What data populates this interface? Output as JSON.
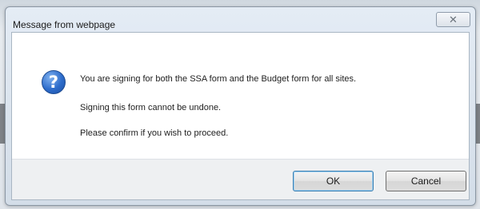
{
  "dialog": {
    "title": "Message from webpage",
    "close_glyph": "✕",
    "icon": "question-icon",
    "icon_glyph": "?",
    "messages": [
      "You are signing for both the SSA form and the Budget form for all sites.",
      "Signing this form cannot be undone.",
      "Please confirm if you wish to proceed."
    ],
    "buttons": {
      "ok_label": "OK",
      "cancel_label": "Cancel"
    }
  }
}
